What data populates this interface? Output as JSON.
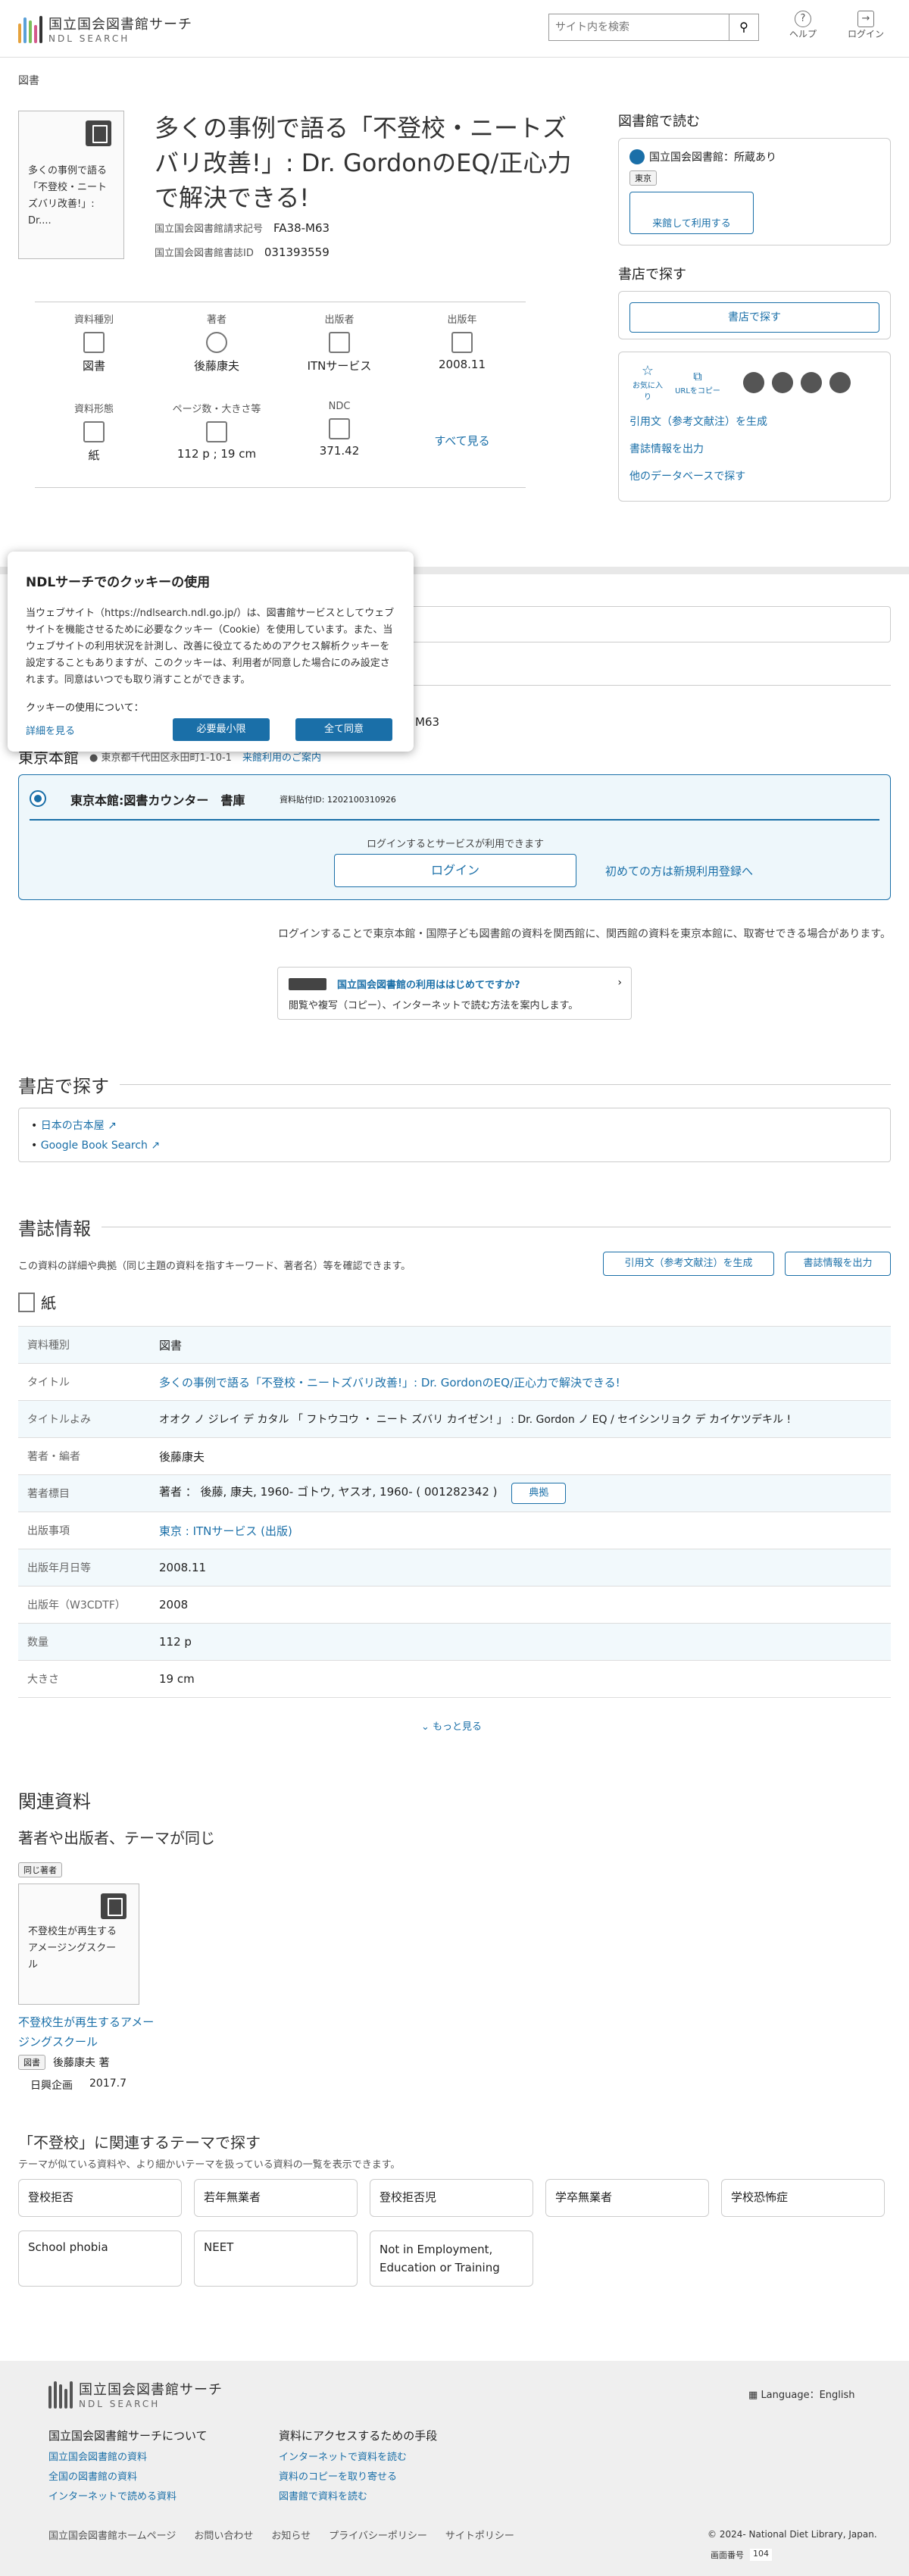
{
  "header": {
    "logo_jp": "国立国会図書館サーチ",
    "logo_en": "NDL SEARCH",
    "search_placeholder": "サイト内を検索",
    "help": "ヘルプ",
    "login": "ログイン"
  },
  "breadcrumb": "図書",
  "book": {
    "cover_text": "多くの事例で語る「不登校・ニートズバリ改善!」: Dr....",
    "title": "多くの事例で語る「不登校・ニートズバリ改善!」: Dr. GordonのEQ/正心力で解決できる!",
    "call_label": "国立国会図書館請求記号",
    "call_no": "FA38-M63",
    "bib_label": "国立国会図書館書誌ID",
    "bib_id": "031393559"
  },
  "facets": [
    {
      "label": "資料種別",
      "value": "図書"
    },
    {
      "label": "著者",
      "value": "後藤康夫"
    },
    {
      "label": "出版者",
      "value": "ITNサービス"
    },
    {
      "label": "出版年",
      "value": "2008.11"
    },
    {
      "label": "資料形態",
      "value": "紙"
    },
    {
      "label": "ページ数・大きさ等",
      "value": "112 p ; 19 cm"
    },
    {
      "label": "NDC",
      "value": "371.42"
    }
  ],
  "facets_more": "すべて見る",
  "right": {
    "read_title": "図書館で読む",
    "ndl_holding": "国立国会図書館：所蔵あり",
    "tokyo_tag": "東京",
    "visit_btn": "来館して利用する",
    "shop_title": "書店で探す",
    "shop_btn": "書店で探す",
    "fav": "お気に入り",
    "url_copy": "URLをコピー",
    "cite": "引用文（参考文献注）を生成",
    "export": "書誌情報を出力",
    "other_db": "他のデータベースで探す"
  },
  "cookie": {
    "title": "NDLサーチでのクッキーの使用",
    "body": "当ウェブサイト（https://ndlsearch.ndl.go.jp/）は、図書館サービスとしてウェブサイトを機能させるために必要なクッキー（Cookie）を使用しています。また、当ウェブサイトの利用状況を計測し、改善に役立てるためのアクセス解析クッキーを設定することもありますが、このクッキーは、利用者が同意した場合にのみ設定されます。同意はいつでも取り消すことができます。",
    "use_label": "クッキーの使用について：",
    "details": "詳細を見る",
    "min_btn": "必要最小限",
    "all_btn": "全て同意"
  },
  "tokyo": {
    "call_tail": "M63",
    "name": "東京本館",
    "address": "東京都千代田区永田町1-10-1",
    "guide": "来館利用のご案内",
    "counter": "東京本館:図書カウンター　書庫",
    "sticker": "資料貼付ID: 1202100310926",
    "login_note": "ログインするとサービスが利用できます",
    "login_btn": "ログイン",
    "register": "初めての方は新規利用登録へ",
    "transfer_note": "ログインすることで東京本館・国際子ども図書館の資料を関西館に、関西館の資料を東京本館に、取寄せできる場合があります。",
    "first_title": "国立国会図書館の利用ははじめてですか?",
    "first_desc": "閲覧や複写（コピー）、インターネットで読む方法を案内します。"
  },
  "bookstore": {
    "title": "書店で探す",
    "links": [
      "日本の古本屋",
      "Google Book Search"
    ]
  },
  "bib": {
    "title": "書誌情報",
    "desc": "この資料の詳細や典拠（同じ主題の資料を指すキーワード、著者名）等を確認できます。",
    "cite": "引用文（参考文献注）を生成",
    "export": "書誌情報を出力",
    "format": "紙",
    "rows": [
      {
        "k": "資料種別",
        "v": "図書"
      },
      {
        "k": "タイトル",
        "v": "多くの事例で語る「不登校・ニートズバリ改善!」: Dr. GordonのEQ/正心力で解決できる!"
      },
      {
        "k": "タイトルよみ",
        "v": "オオク ノ ジレイ デ カタル 「 フトウコウ ・ ニート ズバリ カイゼン! 」 : Dr. Gordon ノ EQ / セイシンリョク デ カイケツデキル !"
      },
      {
        "k": "著者・編者",
        "v": "後藤康夫"
      },
      {
        "k": "著者標目",
        "v": "著者 ： 後藤, 康夫, 1960- ゴトウ, ヤスオ, 1960- ( 001282342 )"
      },
      {
        "k": "出版事項",
        "v": "東京 : ITNサービス (出版)"
      },
      {
        "k": "出版年月日等",
        "v": "2008.11"
      },
      {
        "k": "出版年（W3CDTF）",
        "v": "2008"
      },
      {
        "k": "数量",
        "v": "112 p"
      },
      {
        "k": "大きさ",
        "v": "19 cm"
      }
    ],
    "authority": "典拠",
    "more": "もっと見る"
  },
  "related": {
    "title": "関連資料",
    "sub": "著者や出版者、テーマが同じ",
    "tag": "同じ著者",
    "cover_text": "不登校生が再生するアメージングスクール",
    "book_title": "不登校生が再生するアメージングスクール",
    "book_tag": "図書",
    "author": "後藤康夫 著",
    "publisher": "日興企画",
    "year": "2017.7"
  },
  "themes": {
    "title": "「不登校」に関連するテーマで探す",
    "desc": "テーマが似ている資料や、より細かいテーマを扱っている資料の一覧を表示できます。",
    "items": [
      "登校拒否",
      "若年無業者",
      "登校拒否児",
      "学卒無業者",
      "学校恐怖症",
      "School phobia",
      "NEET",
      "Not in Employment, Education or Training"
    ]
  },
  "footer": {
    "lang": "Language：English",
    "about": "国立国会図書館サーチについて",
    "about_links": [
      "国立国会図書館の資料",
      "全国の図書館の資料",
      "インターネットで読める資料"
    ],
    "access": "資料にアクセスするための手段",
    "access_links": [
      "インターネットで資料を読む",
      "資料のコピーを取り寄せる",
      "図書館で資料を読む"
    ],
    "bottom_links": [
      "国立国会図書館ホームページ",
      "お問い合わせ",
      "お知らせ",
      "プライバシーポリシー",
      "サイトポリシー"
    ],
    "copyright": "© 2024- National Diet Library, Japan.",
    "screen_no_label": "画面番号",
    "screen_no": "104"
  },
  "colors": {
    "accent": "#1a6fa8",
    "location_bg": "#eef7fb"
  },
  "icons": [
    "search-icon",
    "help-icon",
    "login-icon",
    "book-icon",
    "share-x-icon",
    "facebook-icon",
    "line-icon",
    "mail-icon"
  ]
}
